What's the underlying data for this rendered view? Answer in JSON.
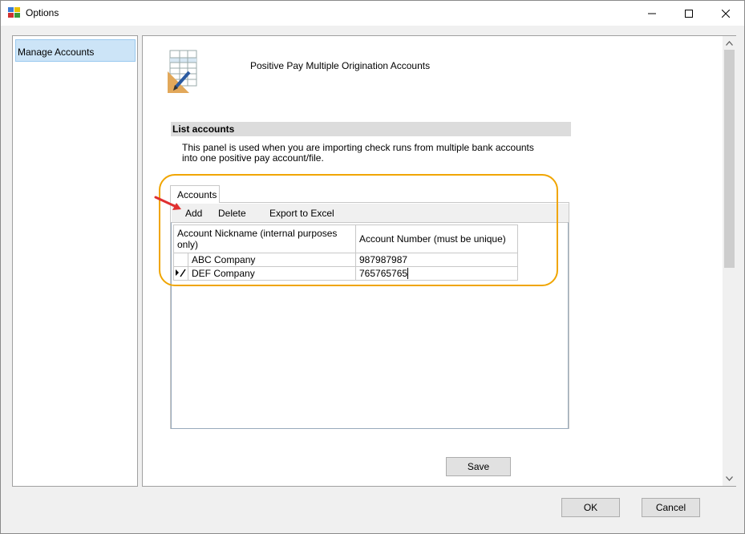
{
  "window": {
    "title": "Options"
  },
  "nav": {
    "items": [
      {
        "label": "Manage Accounts"
      }
    ]
  },
  "main": {
    "header_title": "Positive Pay Multiple Origination Accounts",
    "section_title": "List accounts",
    "description_line1": "This panel is used when you are importing check runs from multiple bank accounts",
    "description_line2": "into one positive pay account/file."
  },
  "tab": {
    "label": "Accounts"
  },
  "toolbar": {
    "add": "Add",
    "delete": "Delete",
    "export": "Export to Excel"
  },
  "grid": {
    "columns": [
      "Account Nickname (internal purposes only)",
      "Account Number (must be unique)"
    ],
    "rows": [
      {
        "nickname": "ABC Company",
        "number": "987987987"
      },
      {
        "nickname": "DEF Company",
        "number": "765765765"
      }
    ]
  },
  "buttons": {
    "save": "Save",
    "ok": "OK",
    "cancel": "Cancel"
  },
  "colors": {
    "highlight": "#f0a500",
    "annotation_arrow": "#e03030",
    "selected_nav": "#cce4f7"
  }
}
